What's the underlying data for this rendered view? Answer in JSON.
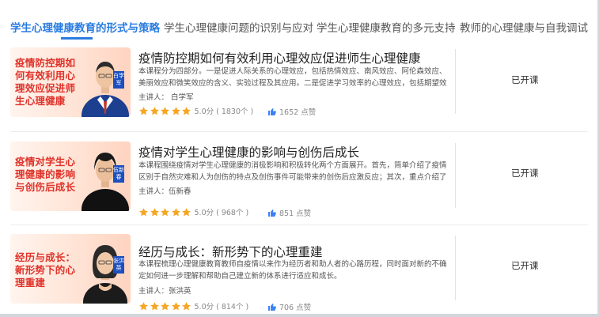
{
  "tabs": [
    {
      "label": "学生心理健康教育的形式与策略",
      "active": true
    },
    {
      "label": "学生心理健康问题的识别与应对",
      "active": false
    },
    {
      "label": "学生心理健康教育的多元支持",
      "active": false
    },
    {
      "label": "教师的心理健康与自我调试",
      "active": false
    }
  ],
  "courses": [
    {
      "thumb_text": "疫情防控期如何有效利用心理效应促进师生心理健康",
      "thumb_name": "白学军",
      "title": "疫情防控期如何有效利用心理效应促进师生心理健康",
      "description": "本课程分为四部分。一是促进人际关系的心理效应，包括热情效应、南风效应、阿伦森效应、美丽效应和微笑效应的含义、实验过程及其应用。二是促进学习效率的心理效应，包括期望效应...",
      "lecturer": "主讲人：  白学军",
      "score": "5.0分",
      "reviews": "( 1830个 )",
      "likes": "1652 点赞",
      "status": "已开课"
    },
    {
      "thumb_text": "疫情对学生心理健康的影响与创伤后成长",
      "thumb_name": "伍新春",
      "title": "疫情对学生心理健康的影响与创伤后成长",
      "description": "本课程围绕疫情对学生心理健康的消极影响和积极转化两个方面展开。首先，简单介绍了疫情区别于自然灾难和人为创伤的特点及创伤事件可能带来的创伤后应激反应；其次，重点介绍了疫...",
      "lecturer": "主讲人：伍新春",
      "score": "5.0分",
      "reviews": "( 968个 )",
      "likes": "851 点赞",
      "status": "已开课"
    },
    {
      "thumb_text": "经历与成长：新形势下的心理重建",
      "thumb_name": "张洪英",
      "title": "经历与成长：新形势下的心理重建",
      "description": "本课程梳理心理健康教育教师自疫情以来作为经历者和助人者的心路历程，同时面对新的不确定如何进一步理解和帮助自己建立新的体系进行适应和成长。",
      "lecturer": "主讲人：张洪英",
      "score": "5.0分",
      "reviews": "( 814个 )",
      "likes": "706 点赞",
      "status": "已开课"
    }
  ],
  "colors": {
    "accent": "#2a7ce0",
    "star": "#f5a623",
    "like": "#3b82f6",
    "thumb_text": "#e0322a"
  }
}
